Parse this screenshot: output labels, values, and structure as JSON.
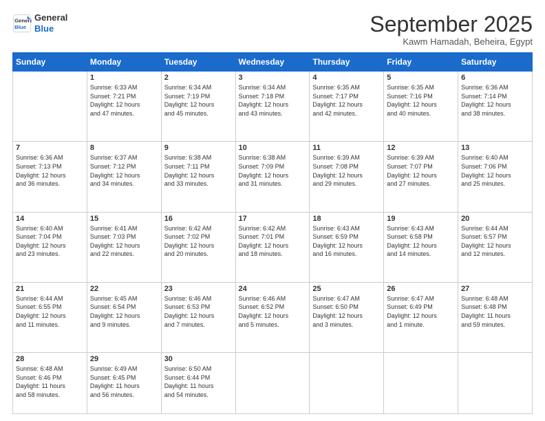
{
  "logo": {
    "line1": "General",
    "line2": "Blue"
  },
  "title": "September 2025",
  "subtitle": "Kawm Hamadah, Beheira, Egypt",
  "days_header": [
    "Sunday",
    "Monday",
    "Tuesday",
    "Wednesday",
    "Thursday",
    "Friday",
    "Saturday"
  ],
  "weeks": [
    [
      {
        "num": "",
        "text": ""
      },
      {
        "num": "1",
        "text": "Sunrise: 6:33 AM\nSunset: 7:21 PM\nDaylight: 12 hours\nand 47 minutes."
      },
      {
        "num": "2",
        "text": "Sunrise: 6:34 AM\nSunset: 7:19 PM\nDaylight: 12 hours\nand 45 minutes."
      },
      {
        "num": "3",
        "text": "Sunrise: 6:34 AM\nSunset: 7:18 PM\nDaylight: 12 hours\nand 43 minutes."
      },
      {
        "num": "4",
        "text": "Sunrise: 6:35 AM\nSunset: 7:17 PM\nDaylight: 12 hours\nand 42 minutes."
      },
      {
        "num": "5",
        "text": "Sunrise: 6:35 AM\nSunset: 7:16 PM\nDaylight: 12 hours\nand 40 minutes."
      },
      {
        "num": "6",
        "text": "Sunrise: 6:36 AM\nSunset: 7:14 PM\nDaylight: 12 hours\nand 38 minutes."
      }
    ],
    [
      {
        "num": "7",
        "text": "Sunrise: 6:36 AM\nSunset: 7:13 PM\nDaylight: 12 hours\nand 36 minutes."
      },
      {
        "num": "8",
        "text": "Sunrise: 6:37 AM\nSunset: 7:12 PM\nDaylight: 12 hours\nand 34 minutes."
      },
      {
        "num": "9",
        "text": "Sunrise: 6:38 AM\nSunset: 7:11 PM\nDaylight: 12 hours\nand 33 minutes."
      },
      {
        "num": "10",
        "text": "Sunrise: 6:38 AM\nSunset: 7:09 PM\nDaylight: 12 hours\nand 31 minutes."
      },
      {
        "num": "11",
        "text": "Sunrise: 6:39 AM\nSunset: 7:08 PM\nDaylight: 12 hours\nand 29 minutes."
      },
      {
        "num": "12",
        "text": "Sunrise: 6:39 AM\nSunset: 7:07 PM\nDaylight: 12 hours\nand 27 minutes."
      },
      {
        "num": "13",
        "text": "Sunrise: 6:40 AM\nSunset: 7:06 PM\nDaylight: 12 hours\nand 25 minutes."
      }
    ],
    [
      {
        "num": "14",
        "text": "Sunrise: 6:40 AM\nSunset: 7:04 PM\nDaylight: 12 hours\nand 23 minutes."
      },
      {
        "num": "15",
        "text": "Sunrise: 6:41 AM\nSunset: 7:03 PM\nDaylight: 12 hours\nand 22 minutes."
      },
      {
        "num": "16",
        "text": "Sunrise: 6:42 AM\nSunset: 7:02 PM\nDaylight: 12 hours\nand 20 minutes."
      },
      {
        "num": "17",
        "text": "Sunrise: 6:42 AM\nSunset: 7:01 PM\nDaylight: 12 hours\nand 18 minutes."
      },
      {
        "num": "18",
        "text": "Sunrise: 6:43 AM\nSunset: 6:59 PM\nDaylight: 12 hours\nand 16 minutes."
      },
      {
        "num": "19",
        "text": "Sunrise: 6:43 AM\nSunset: 6:58 PM\nDaylight: 12 hours\nand 14 minutes."
      },
      {
        "num": "20",
        "text": "Sunrise: 6:44 AM\nSunset: 6:57 PM\nDaylight: 12 hours\nand 12 minutes."
      }
    ],
    [
      {
        "num": "21",
        "text": "Sunrise: 6:44 AM\nSunset: 6:55 PM\nDaylight: 12 hours\nand 11 minutes."
      },
      {
        "num": "22",
        "text": "Sunrise: 6:45 AM\nSunset: 6:54 PM\nDaylight: 12 hours\nand 9 minutes."
      },
      {
        "num": "23",
        "text": "Sunrise: 6:46 AM\nSunset: 6:53 PM\nDaylight: 12 hours\nand 7 minutes."
      },
      {
        "num": "24",
        "text": "Sunrise: 6:46 AM\nSunset: 6:52 PM\nDaylight: 12 hours\nand 5 minutes."
      },
      {
        "num": "25",
        "text": "Sunrise: 6:47 AM\nSunset: 6:50 PM\nDaylight: 12 hours\nand 3 minutes."
      },
      {
        "num": "26",
        "text": "Sunrise: 6:47 AM\nSunset: 6:49 PM\nDaylight: 12 hours\nand 1 minute."
      },
      {
        "num": "27",
        "text": "Sunrise: 6:48 AM\nSunset: 6:48 PM\nDaylight: 11 hours\nand 59 minutes."
      }
    ],
    [
      {
        "num": "28",
        "text": "Sunrise: 6:48 AM\nSunset: 6:46 PM\nDaylight: 11 hours\nand 58 minutes."
      },
      {
        "num": "29",
        "text": "Sunrise: 6:49 AM\nSunset: 6:45 PM\nDaylight: 11 hours\nand 56 minutes."
      },
      {
        "num": "30",
        "text": "Sunrise: 6:50 AM\nSunset: 6:44 PM\nDaylight: 11 hours\nand 54 minutes."
      },
      {
        "num": "",
        "text": ""
      },
      {
        "num": "",
        "text": ""
      },
      {
        "num": "",
        "text": ""
      },
      {
        "num": "",
        "text": ""
      }
    ]
  ]
}
